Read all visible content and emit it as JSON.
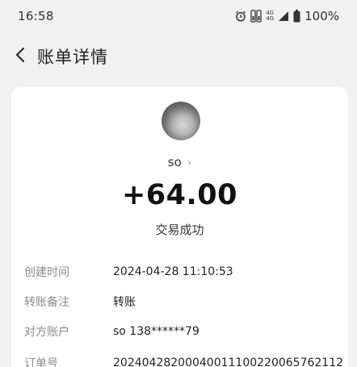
{
  "status_bar": {
    "time": "16:58",
    "network_a": "4G",
    "network_b": "4G",
    "battery": "100%"
  },
  "nav": {
    "title": "账单详情"
  },
  "bill": {
    "payee_name": "so",
    "amount": "+64.00",
    "status": "交易成功",
    "details": [
      {
        "label": "创建时间",
        "value": "2024-04-28 11:10:53"
      },
      {
        "label": "转账备注",
        "value": "转账"
      },
      {
        "label": "对方账户",
        "value": "so 138******79"
      },
      {
        "label": "订单号",
        "value": "20240428200040011100220065762112"
      }
    ]
  },
  "colors": {
    "page_background": "#f1f1f1",
    "card_background": "#ffffff",
    "label_gray": "#8a8a8a"
  },
  "icons": {
    "back": "chevron-left-icon",
    "alarm": "alarm-clock-icon",
    "sim": "dual-sim-icon",
    "signal": "signal-icon",
    "battery": "battery-icon"
  }
}
